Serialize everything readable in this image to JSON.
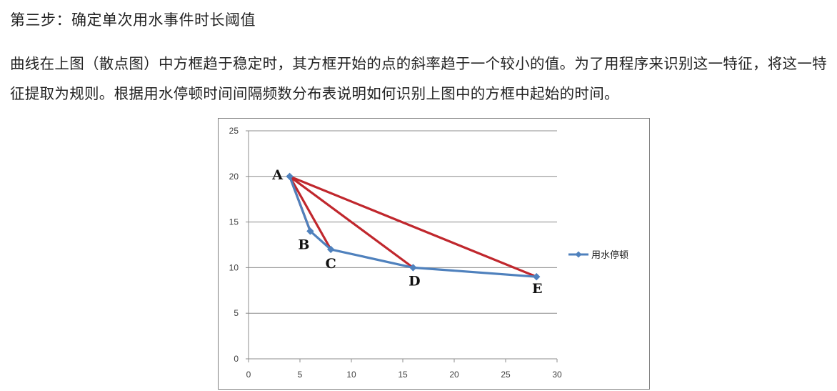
{
  "heading": "第三步：确定单次用水事件时长阈值",
  "paragraph": "曲线在上图（散点图）中方框趋于稳定时，其方框开始的点的斜率趋于一个较小的值。为了用程序来识别这一特征，将这一特征提取为规则。根据用水停顿时间间隔频数分布表说明如何识别上图中的方框中起始的时间。",
  "chart_data": {
    "type": "line",
    "title": "",
    "xlabel": "",
    "ylabel": "",
    "xlim": [
      0,
      30
    ],
    "ylim": [
      0,
      25
    ],
    "xticks": [
      0,
      5,
      10,
      15,
      20,
      25,
      30
    ],
    "yticks": [
      0,
      5,
      10,
      15,
      20,
      25
    ],
    "grid": "horizontal",
    "legend_position": "right",
    "series": [
      {
        "name": "用水停顿",
        "color": "#4f81bd",
        "marker": "diamond",
        "points": [
          {
            "label": "A",
            "x": 4,
            "y": 20
          },
          {
            "label": "B",
            "x": 6,
            "y": 14
          },
          {
            "label": "C",
            "x": 8,
            "y": 12
          },
          {
            "label": "D",
            "x": 16,
            "y": 10
          },
          {
            "label": "E",
            "x": 28,
            "y": 9
          }
        ]
      }
    ],
    "annotation_lines": {
      "color": "#c0272d",
      "from": "A",
      "to": [
        "B",
        "C",
        "D",
        "E"
      ]
    }
  }
}
